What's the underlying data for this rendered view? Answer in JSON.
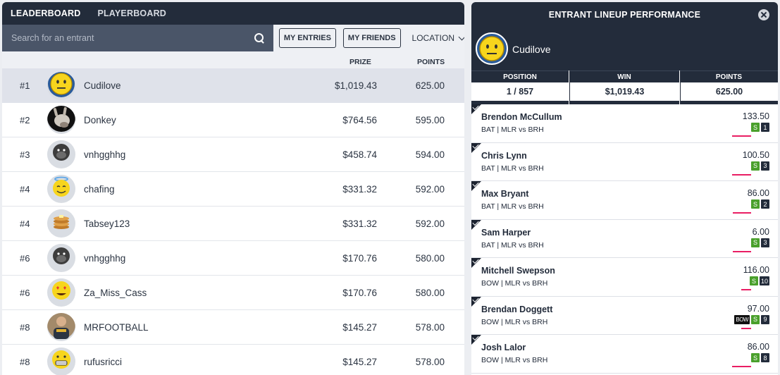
{
  "tabs": {
    "leaderboard": "LEADERBOARD",
    "playerboard": "PLAYERBOARD"
  },
  "search": {
    "placeholder": "Search for an entrant"
  },
  "filters": {
    "my_entries": "MY ENTRIES",
    "my_friends": "MY FRIENDS",
    "location": "LOCATION"
  },
  "columns": {
    "prize": "PRIZE",
    "points": "POINTS"
  },
  "entrants": [
    {
      "rank": "#1",
      "name": "Cudilove",
      "prize": "$1,019.43",
      "points": "625.00",
      "avatar": "neutral-face-icon"
    },
    {
      "rank": "#2",
      "name": "Donkey",
      "prize": "$764.56",
      "points": "595.00",
      "avatar": "donkey-photo-icon"
    },
    {
      "rank": "#3",
      "name": "vnhgghhg",
      "prize": "$458.74",
      "points": "594.00",
      "avatar": "gorilla-icon"
    },
    {
      "rank": "#4",
      "name": "chafing",
      "prize": "$331.32",
      "points": "592.00",
      "avatar": "halo-face-icon"
    },
    {
      "rank": "#4",
      "name": "Tabsey123",
      "prize": "$331.32",
      "points": "592.00",
      "avatar": "pancakes-icon"
    },
    {
      "rank": "#6",
      "name": "vnhgghhg",
      "prize": "$170.76",
      "points": "580.00",
      "avatar": "gorilla-icon"
    },
    {
      "rank": "#6",
      "name": "Za_Miss_Cass",
      "prize": "$170.76",
      "points": "580.00",
      "avatar": "heart-eyes-icon"
    },
    {
      "rank": "#8",
      "name": "MRFOOTBALL",
      "prize": "$145.27",
      "points": "578.00",
      "avatar": "person-photo-icon"
    },
    {
      "rank": "#8",
      "name": "rufusricci",
      "prize": "$145.27",
      "points": "578.00",
      "avatar": "grimace-face-icon"
    }
  ],
  "panel": {
    "title": "ENTRANT LINEUP PERFORMANCE",
    "user": "Cudilove",
    "position_label": "POSITION",
    "position_value": "1 / 857",
    "win_label": "WIN",
    "win_value": "$1,019.43",
    "points_label": "POINTS",
    "points_value": "625.00"
  },
  "players": [
    {
      "name": "Brendon McCullum",
      "info": "BAT | MLR vs BRH",
      "points": "133.50",
      "badges": [
        "S",
        "1"
      ],
      "progress": 0.8
    },
    {
      "name": "Chris Lynn",
      "info": "BAT | MLR vs BRH",
      "points": "100.50",
      "badges": [
        "S",
        "3"
      ],
      "progress": 0.8
    },
    {
      "name": "Max Bryant",
      "info": "BAT | MLR vs BRH",
      "points": "86.00",
      "badges": [
        "S",
        "2"
      ],
      "progress": 0.75
    },
    {
      "name": "Sam Harper",
      "info": "BAT | MLR vs BRH",
      "points": "6.00",
      "badges": [
        "S",
        "3"
      ],
      "progress": 0.75
    },
    {
      "name": "Mitchell Swepson",
      "info": "BOW | MLR vs BRH",
      "points": "116.00",
      "badges": [
        "S",
        "10"
      ],
      "progress": 0.4
    },
    {
      "name": "Brendan Doggett",
      "info": "BOW | MLR vs BRH",
      "points": "97.00",
      "badges": [
        "BOW",
        "S",
        "9"
      ],
      "progress": 0.4
    },
    {
      "name": "Josh Lalor",
      "info": "BOW | MLR vs BRH",
      "points": "86.00",
      "badges": [
        "S",
        "8"
      ],
      "progress": 0.8
    }
  ]
}
